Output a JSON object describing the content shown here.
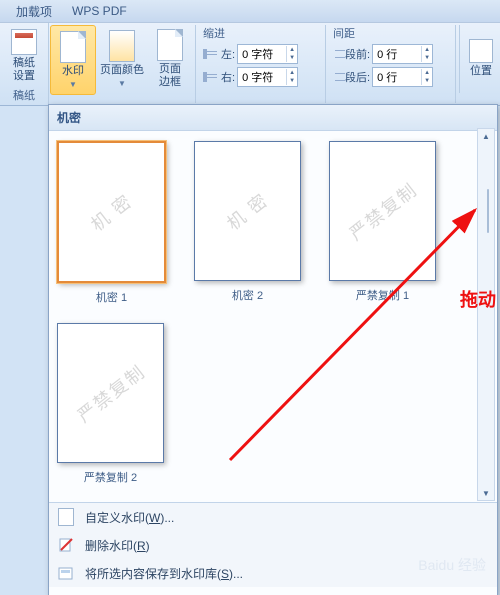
{
  "tabs": {
    "addins": "加载项",
    "wps_pdf": "WPS PDF"
  },
  "ribbon": {
    "left_group": {
      "btn1": "稿纸\n设置",
      "group_label": "稿纸"
    },
    "watermark_btn": "水印",
    "page_color_btn": "页面颜色",
    "page_border_btn": "页面\n边框",
    "indent_grp": "缩进",
    "left_lbl": "左:",
    "right_lbl": "右:",
    "left_val": "0 字符",
    "right_val": "0 字符",
    "spacing_grp": "间距",
    "before_lbl": "段前:",
    "after_lbl": "段后:",
    "before_val": "0 行",
    "after_val": "0 行",
    "position_btn": "位置"
  },
  "dropdown": {
    "header": "机密",
    "items": [
      {
        "wm": "机 密",
        "caption": "机密 1",
        "selected": true
      },
      {
        "wm": "机 密",
        "caption": "机密 2",
        "selected": false
      },
      {
        "wm": "严禁复制",
        "caption": "严禁复制 1",
        "selected": false
      },
      {
        "wm": "严禁复制",
        "caption": "严禁复制 2",
        "selected": false
      }
    ],
    "menu": {
      "custom": {
        "text": "自定义水印(",
        "key": "W",
        "suffix": ")..."
      },
      "remove": {
        "text": "删除水印(",
        "key": "R",
        "suffix": ")"
      },
      "save": {
        "text": "将所选内容保存到水印库(",
        "key": "S",
        "suffix": ")..."
      }
    }
  },
  "annotation": "拖动"
}
